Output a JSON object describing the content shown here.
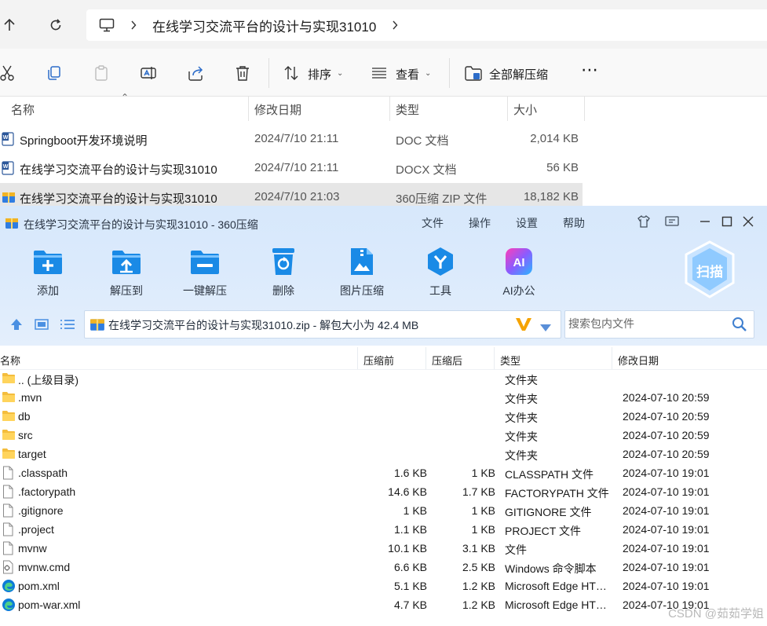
{
  "explorer": {
    "address": {
      "path": "在线学习交流平台的设计与实现31010"
    },
    "toolbar": {
      "sort_label": "排序",
      "view_label": "查看",
      "extract_all_label": "全部解压缩"
    },
    "columns": {
      "name": "名称",
      "date": "修改日期",
      "type": "类型",
      "size": "大小"
    },
    "files": [
      {
        "name": "Springboot开发环境说明",
        "date": "2024/7/10 21:11",
        "type": "DOC 文档",
        "size": "2,014 KB",
        "icon": "word-doc-icon"
      },
      {
        "name": "在线学习交流平台的设计与实现31010",
        "date": "2024/7/10 21:11",
        "type": "DOCX 文档",
        "size": "56 KB",
        "icon": "word-doc-icon"
      },
      {
        "name": "在线学习交流平台的设计与实现31010",
        "date": "2024/7/10 21:03",
        "type": "360压缩 ZIP 文件",
        "size": "18,182 KB",
        "icon": "zip-archive-icon",
        "selected": true
      }
    ]
  },
  "zip": {
    "title": "在线学习交流平台的设计与实现31010 - 360压缩",
    "menu": {
      "file": "文件",
      "operate": "操作",
      "settings": "设置",
      "help": "帮助"
    },
    "tools": [
      {
        "label": "添加",
        "icon": "add-icon"
      },
      {
        "label": "解压到",
        "icon": "extract-to-icon"
      },
      {
        "label": "一键解压",
        "icon": "one-click-extract-icon"
      },
      {
        "label": "删除",
        "icon": "delete-icon"
      },
      {
        "label": "图片压缩",
        "icon": "image-compress-icon"
      },
      {
        "label": "工具",
        "icon": "tools-icon"
      },
      {
        "label": "AI办公",
        "icon": "ai-office-icon"
      }
    ],
    "scan_label": "扫描",
    "address": "在线学习交流平台的设计与实现31010.zip - 解包大小为 42.4 MB",
    "search_placeholder": "搜索包内文件",
    "columns": {
      "name": "名称",
      "before": "压缩前",
      "after": "压缩后",
      "type": "类型",
      "date": "修改日期"
    },
    "rows": [
      {
        "name": ".. (上级目录)",
        "before": "",
        "after": "",
        "type": "文件夹",
        "date": "",
        "icon": "folder-icon"
      },
      {
        "name": ".mvn",
        "before": "",
        "after": "",
        "type": "文件夹",
        "date": "2024-07-10 20:59",
        "icon": "folder-icon"
      },
      {
        "name": "db",
        "before": "",
        "after": "",
        "type": "文件夹",
        "date": "2024-07-10 20:59",
        "icon": "folder-icon"
      },
      {
        "name": "src",
        "before": "",
        "after": "",
        "type": "文件夹",
        "date": "2024-07-10 20:59",
        "icon": "folder-icon"
      },
      {
        "name": "target",
        "before": "",
        "after": "",
        "type": "文件夹",
        "date": "2024-07-10 20:59",
        "icon": "folder-icon"
      },
      {
        "name": ".classpath",
        "before": "1.6 KB",
        "after": "1 KB",
        "type": "CLASSPATH 文件",
        "date": "2024-07-10 19:01",
        "icon": "file-icon"
      },
      {
        "name": ".factorypath",
        "before": "14.6 KB",
        "after": "1.7 KB",
        "type": "FACTORYPATH 文件",
        "date": "2024-07-10 19:01",
        "icon": "file-icon"
      },
      {
        "name": ".gitignore",
        "before": "1 KB",
        "after": "1 KB",
        "type": "GITIGNORE 文件",
        "date": "2024-07-10 19:01",
        "icon": "file-icon"
      },
      {
        "name": ".project",
        "before": "1.1 KB",
        "after": "1 KB",
        "type": "PROJECT 文件",
        "date": "2024-07-10 19:01",
        "icon": "file-icon"
      },
      {
        "name": "mvnw",
        "before": "10.1 KB",
        "after": "3.1 KB",
        "type": "文件",
        "date": "2024-07-10 19:01",
        "icon": "file-icon"
      },
      {
        "name": "mvnw.cmd",
        "before": "6.6 KB",
        "after": "2.5 KB",
        "type": "Windows 命令脚本",
        "date": "2024-07-10 19:01",
        "icon": "cmd-script-icon"
      },
      {
        "name": "pom.xml",
        "before": "5.1 KB",
        "after": "1.2 KB",
        "type": "Microsoft Edge HT…",
        "date": "2024-07-10 19:01",
        "icon": "edge-icon"
      },
      {
        "name": "pom-war.xml",
        "before": "4.7 KB",
        "after": "1.2 KB",
        "type": "Microsoft Edge HT…",
        "date": "2024-07-10 19:01",
        "icon": "edge-icon"
      }
    ]
  },
  "watermark": "CSDN @茹茹学姐"
}
